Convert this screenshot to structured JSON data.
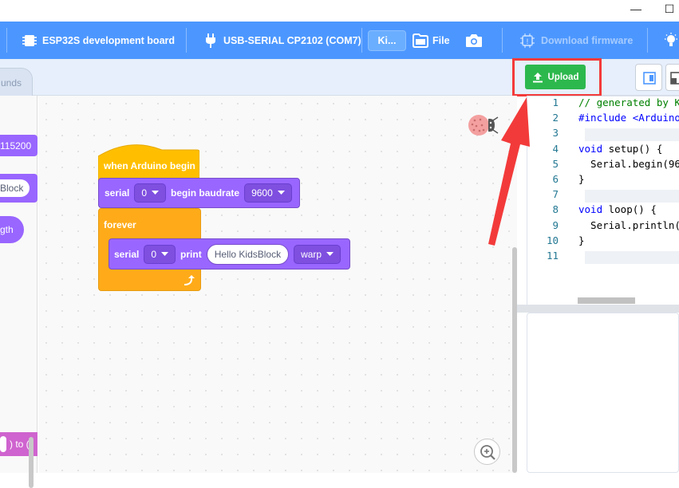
{
  "window": {
    "minimize": "—",
    "maximize": "☐"
  },
  "toolbar": {
    "board_label": "ESP32S development board",
    "port_label": "USB-SERIAL CP2102 (COM7)",
    "kid_tab_label": "Ki...",
    "file_label": "File",
    "download_label": "Download firmware"
  },
  "tabs": {
    "sounds_label": "unds"
  },
  "upload": {
    "label": "Upload",
    "color": "#2db84d",
    "highlight_color": "#f33a3a"
  },
  "palette": {
    "items": [
      "115200",
      "Block",
      "gth",
      ") to ("
    ]
  },
  "blocks": {
    "hat_label": "when Arduino begin",
    "serial_begin": {
      "label": "serial",
      "port": "0",
      "action": "begin baudrate",
      "baud": "9600"
    },
    "forever_label": "forever",
    "serial_print": {
      "label": "serial",
      "port": "0",
      "action": "print",
      "text": "Hello KidsBlock",
      "mode": "warp"
    }
  },
  "code": {
    "lines": [
      {
        "n": "1",
        "text": "// generated by K"
      },
      {
        "n": "2",
        "text": "#include <Arduino"
      },
      {
        "n": "3",
        "text": ""
      },
      {
        "n": "4",
        "text": "void setup() {"
      },
      {
        "n": "5",
        "text": "  Serial.begin(96"
      },
      {
        "n": "6",
        "text": "}"
      },
      {
        "n": "7",
        "text": ""
      },
      {
        "n": "8",
        "text": "void loop() {"
      },
      {
        "n": "9",
        "text": "  Serial.println("
      },
      {
        "n": "10",
        "text": "}"
      },
      {
        "n": "11",
        "text": ""
      }
    ]
  },
  "colors": {
    "toolbar": "#4c97ff",
    "control": "#ffab19",
    "serial": "#9966ff",
    "arrow": "#f33a3a"
  }
}
